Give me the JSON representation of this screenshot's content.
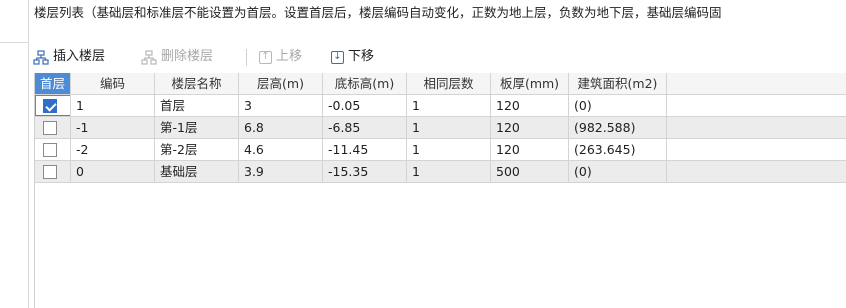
{
  "description": "楼层列表（基础层和标准层不能设置为首层。设置首层后，楼层编码自动变化，正数为地上层，负数为地下层，基础层编码固",
  "toolbar": {
    "insert_label": "插入楼层",
    "delete_label": "删除楼层",
    "up_label": "上移",
    "down_label": "下移"
  },
  "columns": [
    "首层",
    "编码",
    "楼层名称",
    "层高(m)",
    "底标高(m)",
    "相同层数",
    "板厚(mm)",
    "建筑面积(m2)"
  ],
  "rows": [
    {
      "checked": true,
      "code": "1",
      "name": "首层",
      "height": "3",
      "bottom": "-0.05",
      "same": "1",
      "thick": "120",
      "area": "(0)"
    },
    {
      "checked": false,
      "code": "-1",
      "name": "第-1层",
      "height": "6.8",
      "bottom": "-6.85",
      "same": "1",
      "thick": "120",
      "area": "(982.588)"
    },
    {
      "checked": false,
      "code": "-2",
      "name": "第-2层",
      "height": "4.6",
      "bottom": "-11.45",
      "same": "1",
      "thick": "120",
      "area": "(263.645)"
    },
    {
      "checked": false,
      "code": "0",
      "name": "基础层",
      "height": "3.9",
      "bottom": "-15.35",
      "same": "1",
      "thick": "500",
      "area": "(0)"
    }
  ],
  "colors": {
    "header_selected": "#4e8bd6",
    "checkbox": "#2f6fc8",
    "row_alt": "#ececec"
  }
}
